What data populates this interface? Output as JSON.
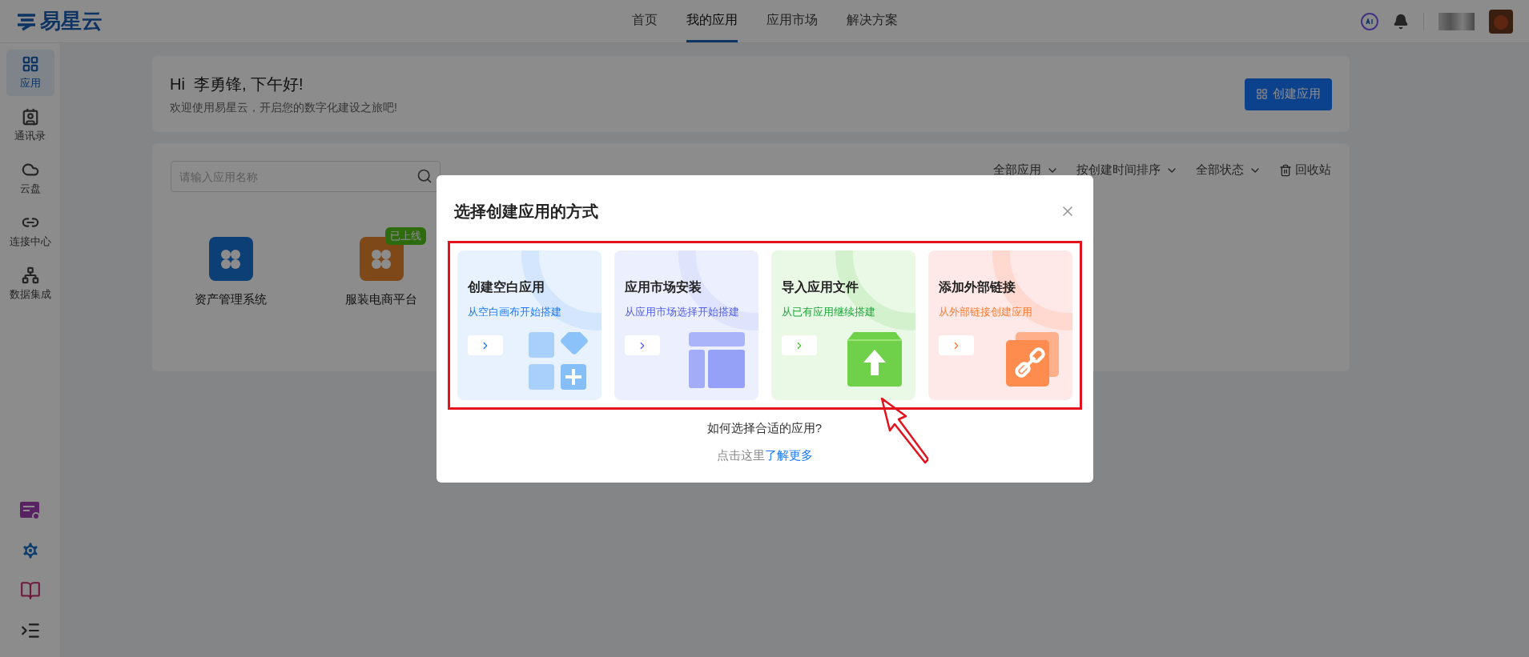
{
  "brand": {
    "name": "易星云"
  },
  "nav": [
    {
      "label": "首页",
      "selected": false
    },
    {
      "label": "我的应用",
      "selected": true
    },
    {
      "label": "应用市场",
      "selected": false
    },
    {
      "label": "解决方案",
      "selected": false
    }
  ],
  "sidebar": {
    "items": [
      {
        "label": "应用",
        "selected": true
      },
      {
        "label": "通讯录",
        "selected": false
      },
      {
        "label": "云盘",
        "selected": false
      },
      {
        "label": "连接中心",
        "selected": false
      },
      {
        "label": "数据集成",
        "selected": false
      }
    ]
  },
  "greeting": {
    "title": "Hi  李勇锋, 下午好!",
    "subtitle": "欢迎使用易星云，开启您的数字化建设之旅吧!",
    "button": "创建应用"
  },
  "search": {
    "placeholder": "请输入应用名称"
  },
  "filters": [
    "全部应用",
    "按创建时间排序",
    "全部状态"
  ],
  "recycle_bin": "回收站",
  "apps": [
    {
      "name": "资产管理系统",
      "kind": "blue"
    },
    {
      "name": "服装电商平台",
      "kind": "orange",
      "badge": "已上线"
    }
  ],
  "modal": {
    "title": "选择创建应用的方式",
    "options": [
      {
        "kind": "blank",
        "title": "创建空白应用",
        "subtitle": "从空白画布开始搭建",
        "color": "#1677ff"
      },
      {
        "kind": "market",
        "title": "应用市场安装",
        "subtitle": "从应用市场选择开始搭建",
        "color": "#4e5cf0"
      },
      {
        "kind": "import",
        "title": "导入应用文件",
        "subtitle": "从已有应用继续搭建",
        "color": "#1aa538"
      },
      {
        "kind": "link",
        "title": "添加外部链接",
        "subtitle": "从外部链接创建应用",
        "color": "#ff7a2e"
      }
    ],
    "help_question": "如何选择合适的应用?",
    "help_prefix": "点击这里",
    "help_link": "了解更多"
  }
}
